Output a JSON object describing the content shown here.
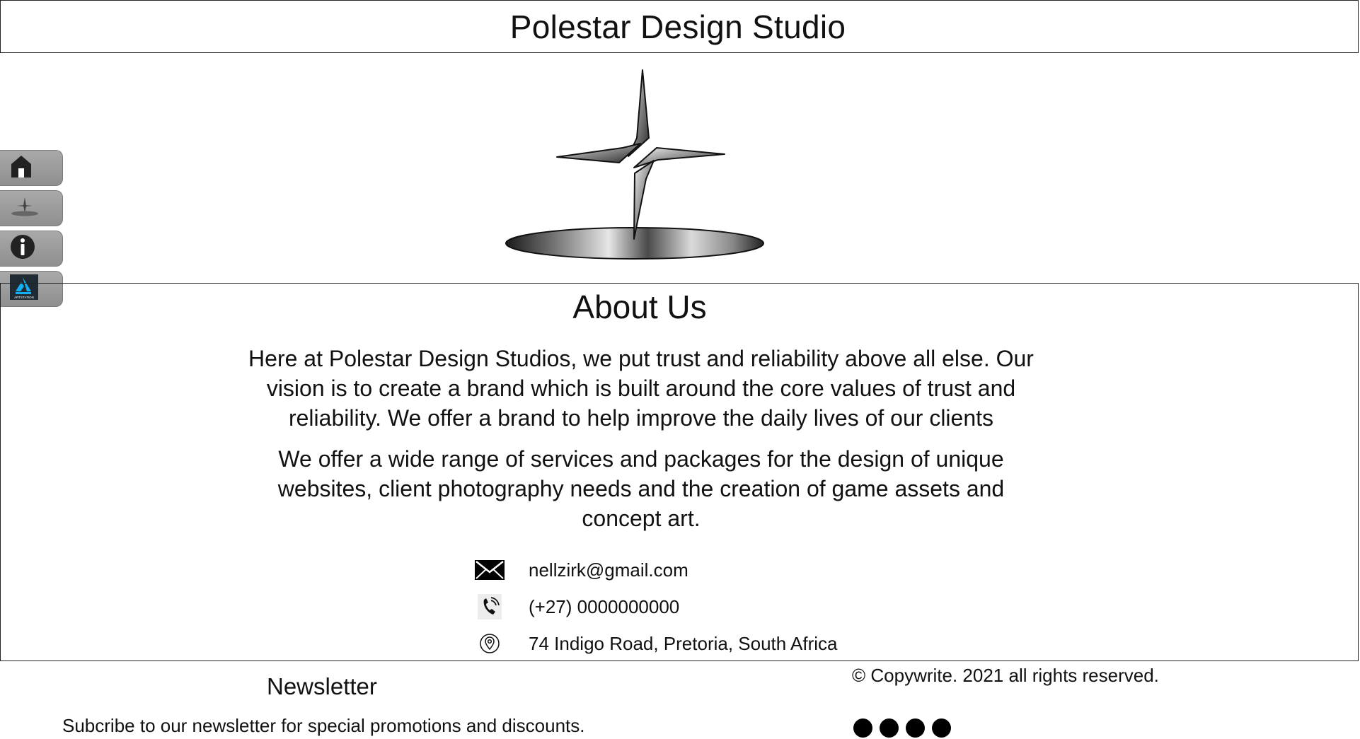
{
  "header": {
    "title": "Polestar Design Studio"
  },
  "logo": {
    "icon": "polestar-star-logo-icon"
  },
  "sidebar": {
    "items": [
      {
        "name": "home",
        "icon": "home-icon"
      },
      {
        "name": "studio",
        "icon": "polestar-mini-icon"
      },
      {
        "name": "info",
        "icon": "info-icon"
      },
      {
        "name": "artstation",
        "icon": "artstation-icon",
        "icon_text": "ARTSTATION"
      }
    ]
  },
  "about": {
    "title": "About Us",
    "paragraph1": "Here at Polestar Design Studios, we put trust and reliability above all else. Our vision is to create a brand which is built around the core values of trust and reliability. We offer a brand to help improve the daily lives of our clients",
    "paragraph2": "We offer a wide range of services and packages for the design of unique websites, client photography needs and the creation of game assets and concept art.",
    "contact": {
      "email": "nellzirk@gmail.com",
      "phone": "(+27) 0000000000",
      "address": "74 Indigo Road, Pretoria, South Africa"
    }
  },
  "footer": {
    "newsletter_title": "Newsletter",
    "newsletter_text": "Subcribe to our newsletter for special promotions and discounts.",
    "copyright": "© Copywrite. 2021 all rights reserved.",
    "social_dots": 4
  }
}
